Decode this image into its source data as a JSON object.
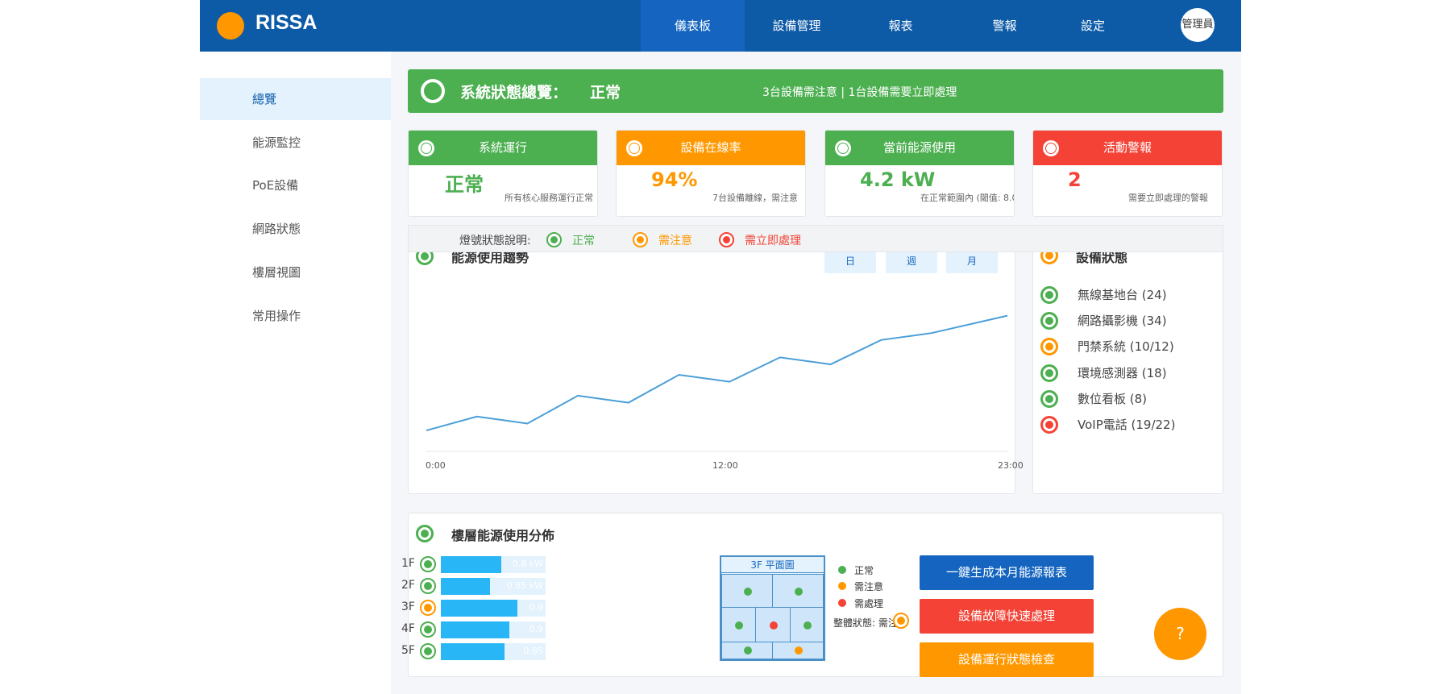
{
  "app": {
    "logo_text": "RISSA"
  },
  "nav": {
    "items": [
      {
        "label": "儀表板",
        "active": true
      },
      {
        "label": "設備管理"
      },
      {
        "label": "報表"
      },
      {
        "label": "警報"
      },
      {
        "label": "設定"
      }
    ],
    "user_label": "管理員"
  },
  "sidebar": {
    "items": [
      {
        "label": "總覽",
        "active": true
      },
      {
        "label": "能源監控"
      },
      {
        "label": "PoE設備"
      },
      {
        "label": "網路狀態"
      },
      {
        "label": "樓層視圖"
      },
      {
        "label": "常用操作"
      }
    ]
  },
  "banner": {
    "title": "系統狀態總覽：",
    "state": "正常",
    "summary": "3台設備需注意 | 1台設備需要立即處理"
  },
  "cards": [
    {
      "title": "系統運行",
      "value": "正常",
      "desc": "所有核心服務運行正常",
      "color": "#4caf50"
    },
    {
      "title": "設備在線率",
      "value": "94%",
      "desc": "7台設備離線，需注意",
      "color": "#ff9800"
    },
    {
      "title": "當前能源使用",
      "value": "4.2 kW",
      "desc": "在正常範圍內 (閾值: 8.0",
      "color": "#4caf50"
    },
    {
      "title": "活動警報",
      "value": "2",
      "desc": "需要立即處理的警報",
      "color": "#f44336"
    }
  ],
  "legend": {
    "label": "燈號狀態說明:",
    "normal": "正常",
    "warning": "需注意",
    "critical": "需立即處理"
  },
  "energy_trend": {
    "title": "能源使用趨勢",
    "ranges": [
      "日",
      "週",
      "月"
    ],
    "x_ticks": [
      "0:00",
      "12:00",
      "23:00"
    ]
  },
  "chart_data": {
    "type": "line",
    "title": "能源使用趨勢",
    "xlabel": "",
    "ylabel": "",
    "x": [
      0,
      2,
      4,
      6,
      8,
      10,
      12,
      14,
      16,
      18,
      20,
      23
    ],
    "values": [
      2.1,
      2.5,
      2.3,
      3.1,
      2.9,
      3.7,
      3.5,
      4.2,
      4.0,
      4.7,
      4.9,
      5.4
    ],
    "ylim": [
      1.5,
      5.9
    ],
    "x_tick_labels": [
      "0:00",
      "12:00",
      "23:00"
    ],
    "grid": false,
    "color": "#4a9fd8"
  },
  "device_status": {
    "title": "設備狀態",
    "items": [
      {
        "label": "無線基地台 (24)",
        "status": "normal"
      },
      {
        "label": "網路攝影機 (34)",
        "status": "normal"
      },
      {
        "label": "門禁系統 (10/12)",
        "status": "warning"
      },
      {
        "label": "環境感測器 (18)",
        "status": "normal"
      },
      {
        "label": "數位看板 (8)",
        "status": "normal"
      },
      {
        "label": "VoIP電話 (19/22)",
        "status": "critical"
      }
    ]
  },
  "floor_energy": {
    "title": "樓層能源使用分佈",
    "floors": [
      {
        "label": "1F",
        "value_label": "0.8 kW",
        "fraction": 0.58,
        "status": "normal"
      },
      {
        "label": "2F",
        "value_label": "0.65 kW",
        "fraction": 0.47,
        "status": "normal"
      },
      {
        "label": "3F",
        "value_label": "0.9",
        "fraction": 0.73,
        "status": "warning"
      },
      {
        "label": "4F",
        "value_label": "0.9",
        "fraction": 0.65,
        "status": "normal"
      },
      {
        "label": "5F",
        "value_label": "0.85",
        "fraction": 0.61,
        "status": "normal"
      }
    ]
  },
  "floor_plan": {
    "title": "3F 平面圖",
    "legend_normal": "正常",
    "legend_warning": "需注意",
    "legend_critical": "需處理",
    "overall_label": "整體狀態: 需注"
  },
  "actions": {
    "report": "一鍵生成本月能源報表",
    "fault": "設備故障快速處理",
    "check": "設備運行狀態檢查"
  },
  "help": {
    "label": "?"
  },
  "colors": {
    "primary": "#0d5aa7",
    "normal": "#4caf50",
    "warning": "#ff9800",
    "critical": "#f44336",
    "report_button": "#1565c0"
  }
}
